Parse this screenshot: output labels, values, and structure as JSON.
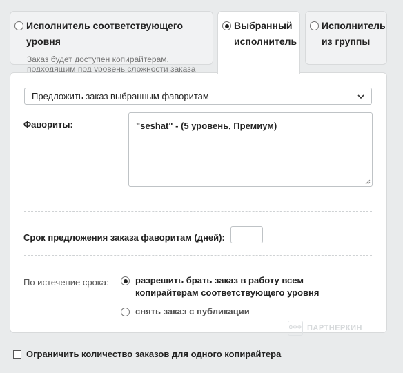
{
  "tabs": [
    {
      "title": "Исполнитель соответствующего уровня",
      "description_line1": "Заказ будет доступен копирайтерам,",
      "description_line2": "подходящим под уровень сложности заказа",
      "selected": false
    },
    {
      "title_line1": "Выбранный",
      "title_line2": "исполнитель",
      "selected": true
    },
    {
      "title_line1": "Исполнитель",
      "title_line2": "из группы",
      "selected": false
    }
  ],
  "panel": {
    "select_value": "Предложить заказ выбранным фаворитам",
    "favorites_label": "Фавориты:",
    "favorites_value": "\"seshat\" - (5 уровень, Премиум)",
    "term_label": "Срок предложения заказа фаворитам (дней):",
    "term_value": "",
    "expire_label": "По истечение срока:",
    "options": [
      {
        "line1": "разрешить брать заказ в работу всем",
        "line2": "копирайтерам соответствующего уровня",
        "selected": true
      },
      {
        "line1": "снять заказ с публикации",
        "selected": false
      }
    ],
    "watermark_icon": "ОФФ",
    "watermark": "ПАРТНЕРКИН"
  },
  "limit": {
    "label": "Ограничить количество заказов для одного копирайтера",
    "checked": false
  }
}
